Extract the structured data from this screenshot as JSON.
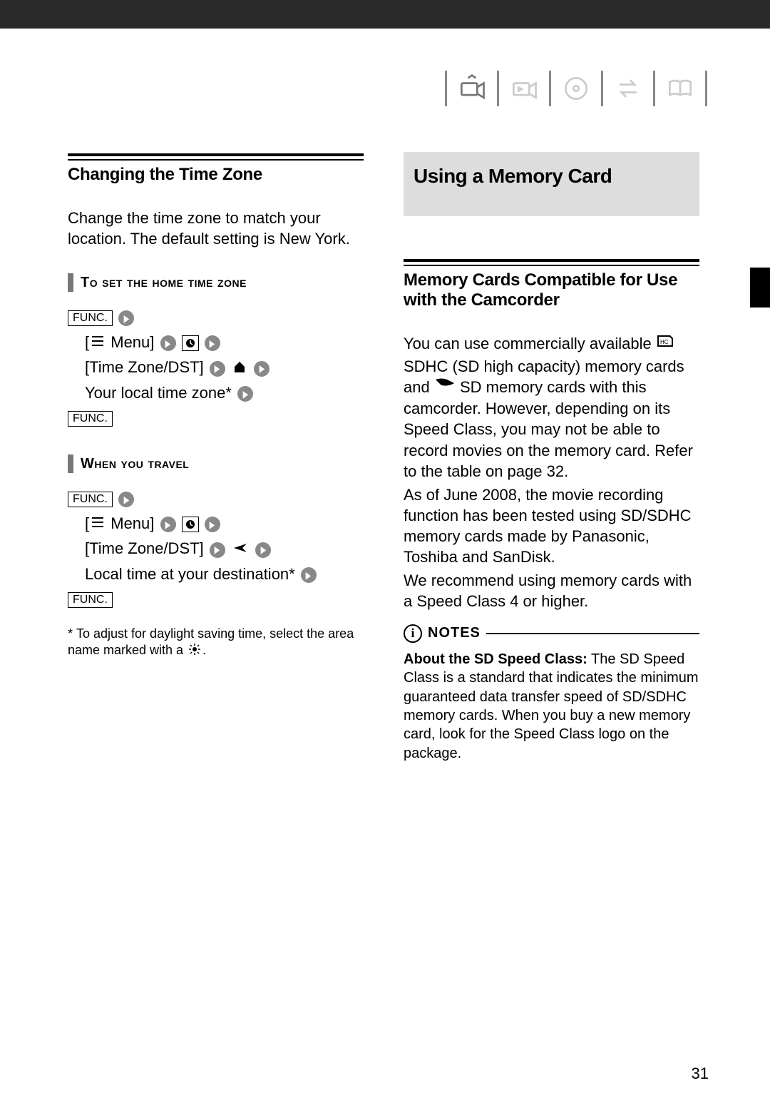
{
  "page_number": "31",
  "nav_icons": [
    "camera-mode-icon",
    "playback-icon",
    "disc-icon",
    "transfer-icon",
    "book-icon"
  ],
  "left": {
    "heading": "Changing the Time Zone",
    "intro": "Change the time zone to match your location. The default setting is New York.",
    "block1": {
      "subhead": "To set the home time zone",
      "func_label": "FUNC.",
      "line_menu": "Menu]",
      "line_tz": "[Time Zone/DST]",
      "line_local": "Your local time zone*"
    },
    "block2": {
      "subhead": "When you travel",
      "func_label": "FUNC.",
      "line_menu": "Menu]",
      "line_tz": "[Time Zone/DST]",
      "line_dest": "Local time at your destination*"
    },
    "footnote": "To adjust for daylight saving time, select the area name marked with a",
    "footnote_tail": "."
  },
  "right": {
    "section_title": "Using a Memory Card",
    "heading": "Memory Cards Compatible for Use with the Camcorder",
    "para1a": "You can use commercially available",
    "para1b": "SDHC (SD high capacity) memory cards and",
    "para1c": "SD memory cards with this camcorder. However, depending on its Speed Class, you may not be able to record movies on the memory card. Refer to the table on page 32.",
    "para2": "As of June 2008, the movie recording function has been tested using SD/SDHC memory cards made by Panasonic, Toshiba and SanDisk.",
    "para3": "We recommend using memory cards with a Speed Class 4 or higher.",
    "notes_label": "NOTES",
    "notes_bold": "About the SD Speed Class:",
    "notes_body": "The SD Speed Class is a standard that indicates the minimum guaranteed data transfer speed of SD/SDHC memory cards. When you buy a new memory card, look for the Speed Class logo on the package."
  }
}
